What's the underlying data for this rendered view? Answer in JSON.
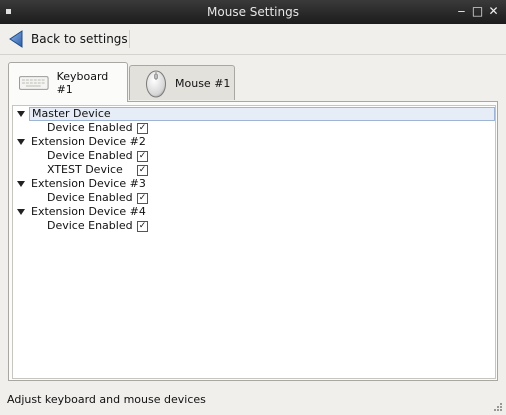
{
  "window": {
    "title": "Mouse Settings",
    "controls": {
      "minimize": "‒",
      "maximize": "□",
      "close": "✕"
    }
  },
  "toolbar": {
    "back_label": "Back to settings"
  },
  "tabs": [
    {
      "label": "Keyboard #1",
      "icon": "keyboard-icon",
      "active": true
    },
    {
      "label": "Mouse #1",
      "icon": "mouse-icon",
      "active": false
    }
  ],
  "tree": {
    "nodes": [
      {
        "label": "Master Device",
        "children": [
          {
            "label": "Device Enabled",
            "checked": true
          }
        ]
      },
      {
        "label": "Extension Device #2",
        "children": [
          {
            "label": "Device Enabled",
            "checked": true
          },
          {
            "label": "XTEST Device",
            "checked": true
          }
        ]
      },
      {
        "label": "Extension Device #3",
        "children": [
          {
            "label": "Device Enabled",
            "checked": true
          }
        ]
      },
      {
        "label": "Extension Device #4",
        "children": [
          {
            "label": "Device Enabled",
            "checked": true
          }
        ]
      }
    ],
    "check_glyph": "✓"
  },
  "status": {
    "text": "Adjust keyboard and mouse devices"
  },
  "colors": {
    "titlebar": "#2a2a2a",
    "back_arrow": "#3c6fb8",
    "selection": "#e6edf6"
  }
}
